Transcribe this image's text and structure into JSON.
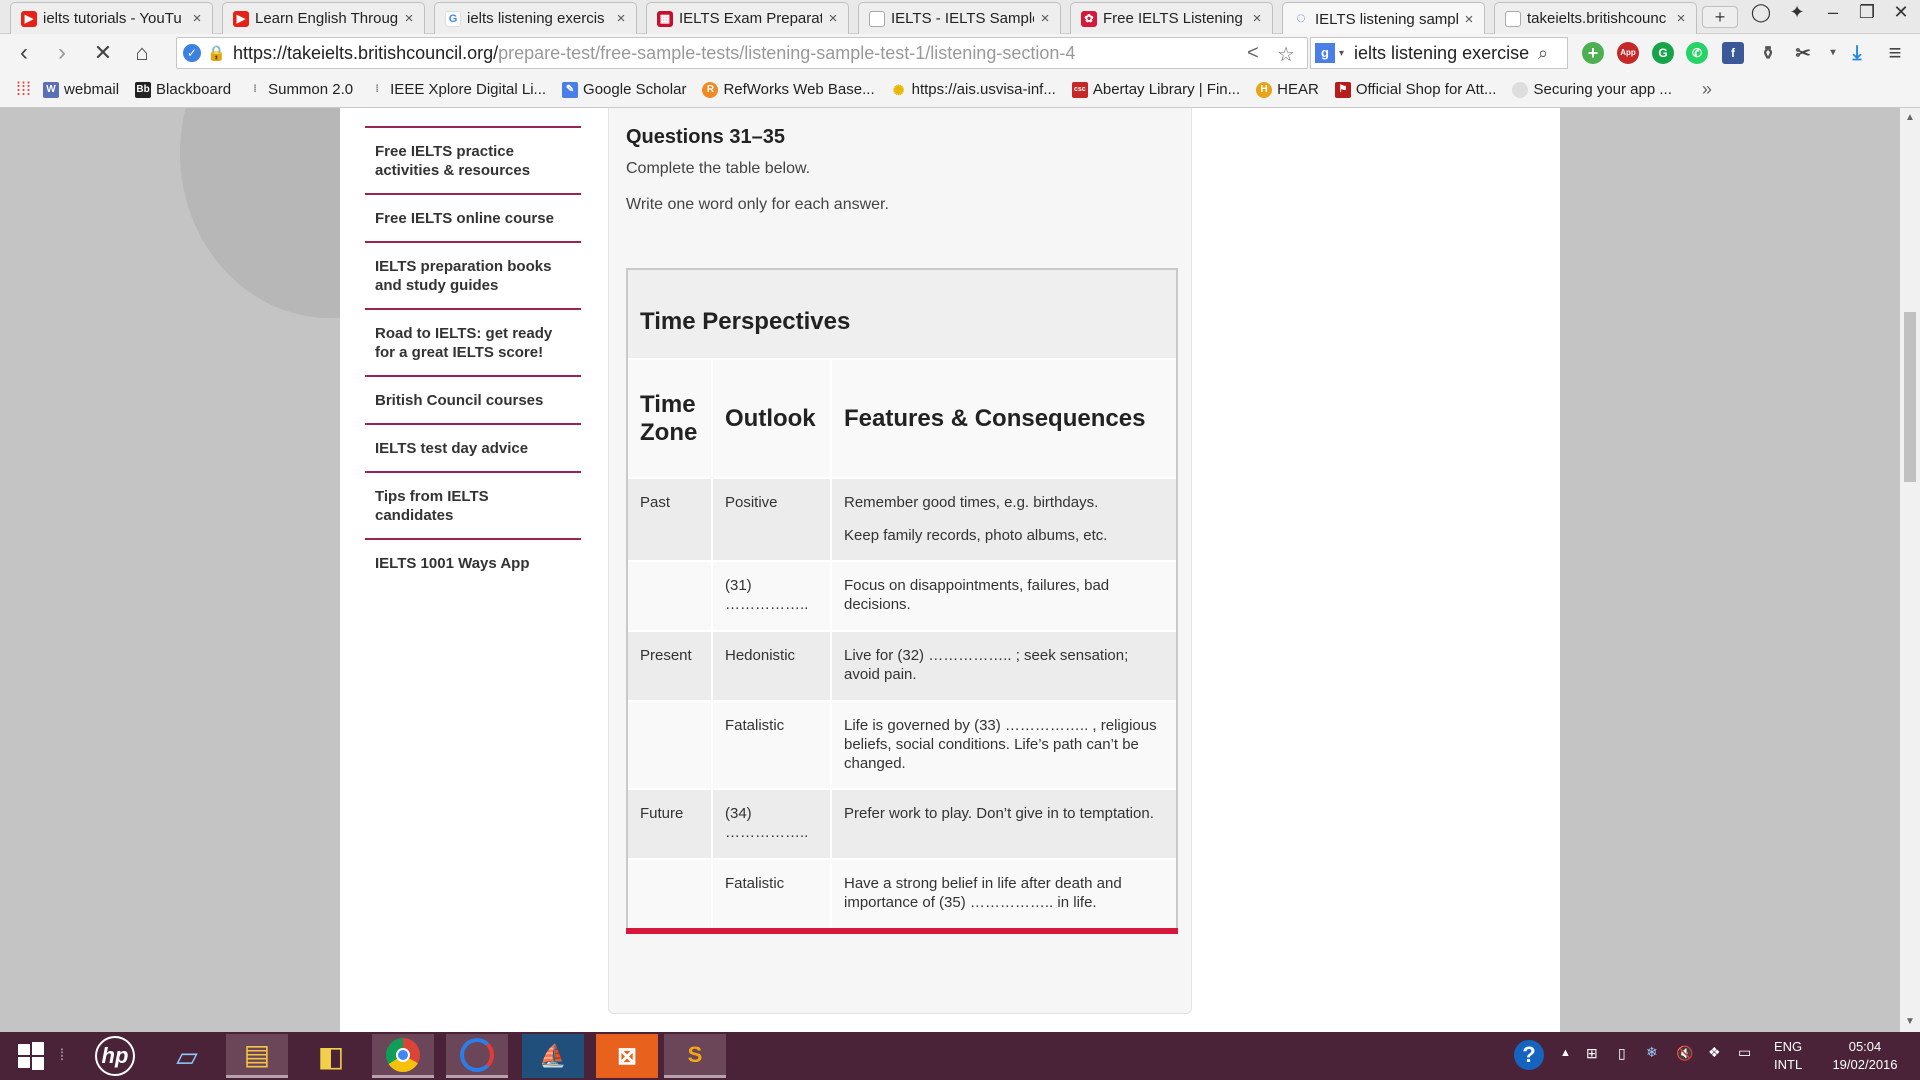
{
  "browser": {
    "tabs": [
      {
        "title": "ielts tutorials - YouTu",
        "icon": "youtube-icon"
      },
      {
        "title": "Learn English Throug",
        "icon": "youtube-icon"
      },
      {
        "title": "ielts listening exercis",
        "icon": "google-icon"
      },
      {
        "title": "IELTS Exam Preparati",
        "icon": "ielts-logo-icon"
      },
      {
        "title": "IELTS - IELTS Sample",
        "icon": "page-icon"
      },
      {
        "title": "Free IELTS Listening",
        "icon": "ielts-logo-icon"
      },
      {
        "title": "IELTS listening sampl",
        "icon": "loading-icon"
      },
      {
        "title": "takeielts.britishcounc",
        "icon": "page-icon"
      }
    ],
    "url_base": "https://takeielts.britishcouncil.org/",
    "url_path": "prepare-test/free-sample-tests/listening-sample-test-1/listening-section-4",
    "search_query": "ielts listening exercise",
    "extension_badge": "App 1"
  },
  "bookmarks": [
    {
      "label": "webmail"
    },
    {
      "label": "Blackboard"
    },
    {
      "label": "Summon 2.0"
    },
    {
      "label": "IEEE Xplore Digital Li..."
    },
    {
      "label": "Google Scholar"
    },
    {
      "label": "RefWorks Web Base..."
    },
    {
      "label": "https://ais.usvisa-inf..."
    },
    {
      "label": "Abertay Library | Fin..."
    },
    {
      "label": "HEAR"
    },
    {
      "label": "Official Shop for Att..."
    },
    {
      "label": "Securing your app ..."
    }
  ],
  "sidebar": {
    "items": [
      {
        "label": "Free IELTS practice activities & resources"
      },
      {
        "label": "Free IELTS online course"
      },
      {
        "label": "IELTS preparation books and study guides"
      },
      {
        "label": "Road to IELTS: get ready for a great IELTS score!"
      },
      {
        "label": "British Council courses"
      },
      {
        "label": "IELTS test day advice"
      },
      {
        "label": "Tips from IELTS candidates"
      },
      {
        "label": "IELTS 1001 Ways App"
      }
    ]
  },
  "main": {
    "title": "Questions 31–35",
    "instruction_1": "Complete the table below.",
    "instruction_2": "Write one word only for each answer.",
    "table": {
      "caption": "Time Perspectives",
      "headers": [
        "Time Zone",
        "Outlook",
        "Features & Consequences"
      ],
      "rows": [
        {
          "zone": "Past",
          "outlook": "Positive",
          "features": [
            "Remember good times, e.g. birthdays.",
            "Keep family records, photo albums, etc."
          ]
        },
        {
          "zone": "",
          "outlook": "(31) ……………..",
          "features": [
            "Focus on disappointments, failures, bad decisions."
          ]
        },
        {
          "zone": "Present",
          "outlook": "Hedonistic",
          "features": [
            "Live for (32) …………….. ; seek sensation; avoid pain."
          ]
        },
        {
          "zone": "",
          "outlook": "Fatalistic",
          "features": [
            "Life is governed by (33) …………….. , religious beliefs, social conditions. Life’s path can’t be changed."
          ]
        },
        {
          "zone": "Future",
          "outlook": "(34) ……………..",
          "features": [
            "Prefer work to play. Don’t give in to temptation."
          ]
        },
        {
          "zone": "",
          "outlook": "Fatalistic",
          "features": [
            "Have a strong belief in life after death and importance of (35) …………….. in life."
          ]
        }
      ]
    }
  },
  "taskbar": {
    "language_line_1": "ENG",
    "language_line_2": "INTL",
    "time": "05:04",
    "date": "19/02/2016"
  },
  "colors": {
    "nav_divider": "#9b2255",
    "accent_red": "#d6183a",
    "taskbar": "#4a2338"
  }
}
